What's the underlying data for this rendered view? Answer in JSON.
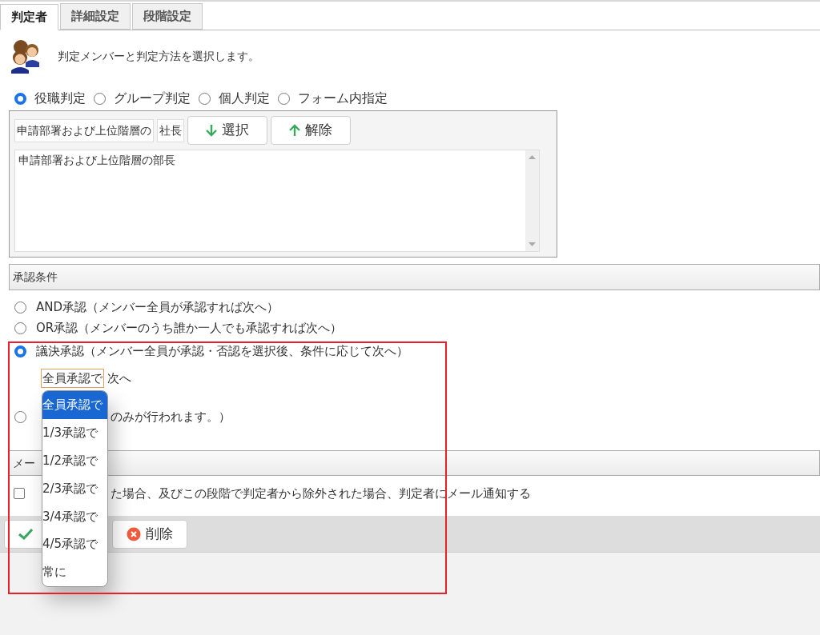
{
  "tabs": [
    {
      "label": "判定者",
      "selected": true
    },
    {
      "label": "詳細設定",
      "selected": false
    },
    {
      "label": "段階設定",
      "selected": false
    }
  ],
  "intro": {
    "text": "判定メンバーと判定方法を選択します。"
  },
  "judge_types": [
    {
      "label": "役職判定",
      "selected": true
    },
    {
      "label": "グループ判定",
      "selected": false
    },
    {
      "label": "個人判定",
      "selected": false
    },
    {
      "label": "フォーム内指定",
      "selected": false
    }
  ],
  "member_picker": {
    "fields": [
      {
        "value": "申請部署および上位階層の"
      },
      {
        "value": "社長"
      }
    ],
    "buttons": [
      {
        "label": "選択",
        "kind": "down"
      },
      {
        "label": "解除",
        "kind": "up"
      }
    ],
    "list_items": [
      "申請部署および上位階層の部長"
    ]
  },
  "approval_section": {
    "title": "承認条件",
    "options": [
      {
        "label": "AND承認（メンバー全員が承認すれば次へ）",
        "selected": false
      },
      {
        "label": "OR承認（メンバーのうち誰か一人でも承認すれば次へ）",
        "selected": false
      },
      {
        "label": "議決承認（メンバー全員が承認・否認を選択後、条件に応じて次へ）",
        "selected": true,
        "select": {
          "value": "全員承認で",
          "suffix": "次へ"
        }
      },
      {
        "label_end": "のみが行われます。）",
        "selected": false
      }
    ]
  },
  "mail_section": {
    "title": "メー",
    "checkbox": {
      "checked": false,
      "label_end": "た場合、及びこの段階で判定者から除外された場合、判定者にメール通知する"
    }
  },
  "action_buttons": [
    {
      "kind": "save"
    },
    {
      "kind": "delete",
      "label": "削除"
    }
  ],
  "dropdown": {
    "options": [
      {
        "label": "全員承認で",
        "selected": true
      },
      {
        "label": "1/3承認で",
        "selected": false
      },
      {
        "label": "1/2承認で",
        "selected": false
      },
      {
        "label": "2/3承認で",
        "selected": false
      },
      {
        "label": "3/4承認で",
        "selected": false
      },
      {
        "label": "4/5承認で",
        "selected": false
      },
      {
        "label": "常に",
        "selected": false
      }
    ]
  }
}
